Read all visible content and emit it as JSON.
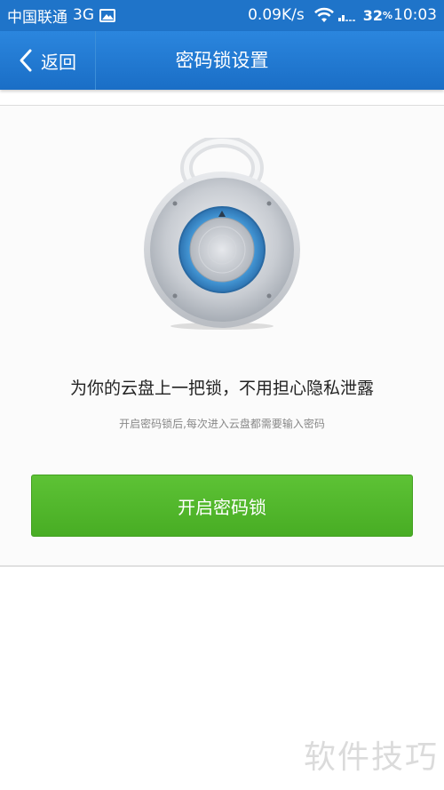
{
  "status_bar": {
    "carrier": "中国联通",
    "network": "3G",
    "image_icon": "image-icon",
    "speed": "0.09K/s",
    "wifi_icon": "wifi-icon",
    "signal_icon": "signal-icon",
    "battery_value": "32",
    "battery_unit": "%",
    "time": "10:03"
  },
  "nav": {
    "back_label": "返回",
    "back_icon": "chevron-left-icon",
    "title": "密码锁设置"
  },
  "content": {
    "illustration_icon": "padlock-icon",
    "headline": "为你的云盘上一把锁，不用担心隐私泄露",
    "subtext": "开启密码锁后,每次进入云盘都需要输入密码",
    "button_label": "开启密码锁"
  },
  "watermark": "软件技巧",
  "colors": {
    "nav_blue": "#1f74c9",
    "button_green": "#52b72c",
    "lock_ring_blue": "#3a8fcf"
  }
}
